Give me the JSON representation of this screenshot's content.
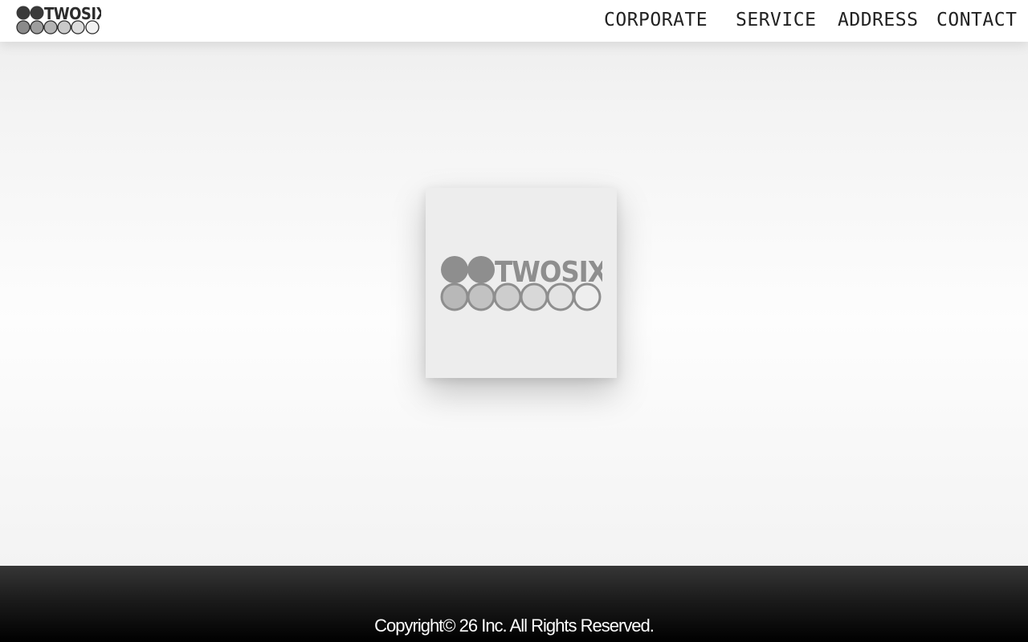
{
  "header": {
    "logo": {
      "text": "TWOSIX",
      "icon": "twosix-circles-logo"
    },
    "nav": [
      {
        "label": "CORPORATE"
      },
      {
        "label": "SERVICE"
      },
      {
        "label": "ADDRESS"
      },
      {
        "label": "CONTACT"
      }
    ]
  },
  "hero": {
    "logo": {
      "text": "TWOSIX",
      "icon": "twosix-circles-logo"
    }
  },
  "footer": {
    "copyright": "Copyright© 26 Inc. All Rights Reserved."
  },
  "colors": {
    "nav_text": "#222222",
    "footer_top": "#363636",
    "footer_bottom": "#000000",
    "card_bg": "#ededed",
    "logo_hero_gray": "#8e8e8e"
  }
}
